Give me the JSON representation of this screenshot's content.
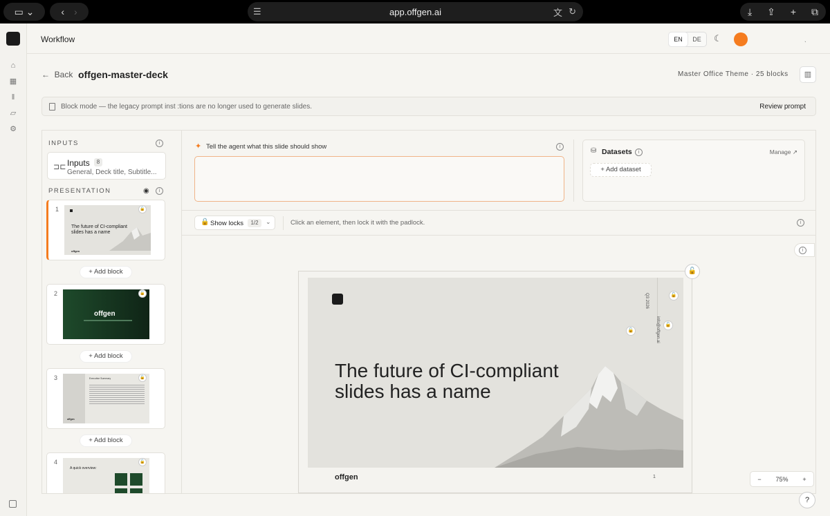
{
  "browser": {
    "url": "app.offgen.ai"
  },
  "header": {
    "title": "Workflow",
    "lang_en": "EN",
    "lang_de": "DE"
  },
  "subheader": {
    "back_label": "Back",
    "deck_title": "offgen-master-deck",
    "theme": "Master Office  Theme",
    "separator": "·",
    "blocks_count": "25 blocks"
  },
  "notice": {
    "text": "Block mode — the legacy prompt inst   :tions are no longer used to generate slides.",
    "action": "Review prompt"
  },
  "left": {
    "inputs_section": "INPUTS",
    "inputs_title": "Inputs",
    "inputs_count": "8",
    "inputs_subtitle": "General, Deck title, Subtitle...",
    "presentation_section": "PRESENTATION",
    "add_block_label": "+ Add block",
    "slides": [
      {
        "num": "1",
        "thumb_text": "The future of CI-compliant slides has a name",
        "footer": "offgen"
      },
      {
        "num": "2",
        "thumb_text": "offgen",
        "footer": ""
      },
      {
        "num": "3",
        "thumb_text": "Executive Summary",
        "footer": "offgen"
      },
      {
        "num": "4",
        "thumb_text": "A quick overview:",
        "footer": ""
      }
    ]
  },
  "main": {
    "prompt_label": "Tell the agent what this slide should show",
    "prompt_value": "",
    "datasets_title": "Datasets",
    "manage_label": "Manage",
    "add_dataset_label": "+ Add dataset",
    "show_locks_label": "Show locks",
    "locks_count": "1/2",
    "hint": "Click an element, then lock it with the padlock.",
    "zoom_minus": "−",
    "zoom_value": "75%",
    "zoom_plus": "+"
  },
  "slide": {
    "title": "The future of CI-compliant slides has a name",
    "vertical_text_1": "Q3 2026",
    "vertical_text_2": "info@offgen.ai",
    "brand": "offgen",
    "page_number": "1"
  },
  "colors": {
    "accent": "#f57c1f",
    "dark_green": "#1e4a2b",
    "slide_bg": "#e3e2dd"
  }
}
